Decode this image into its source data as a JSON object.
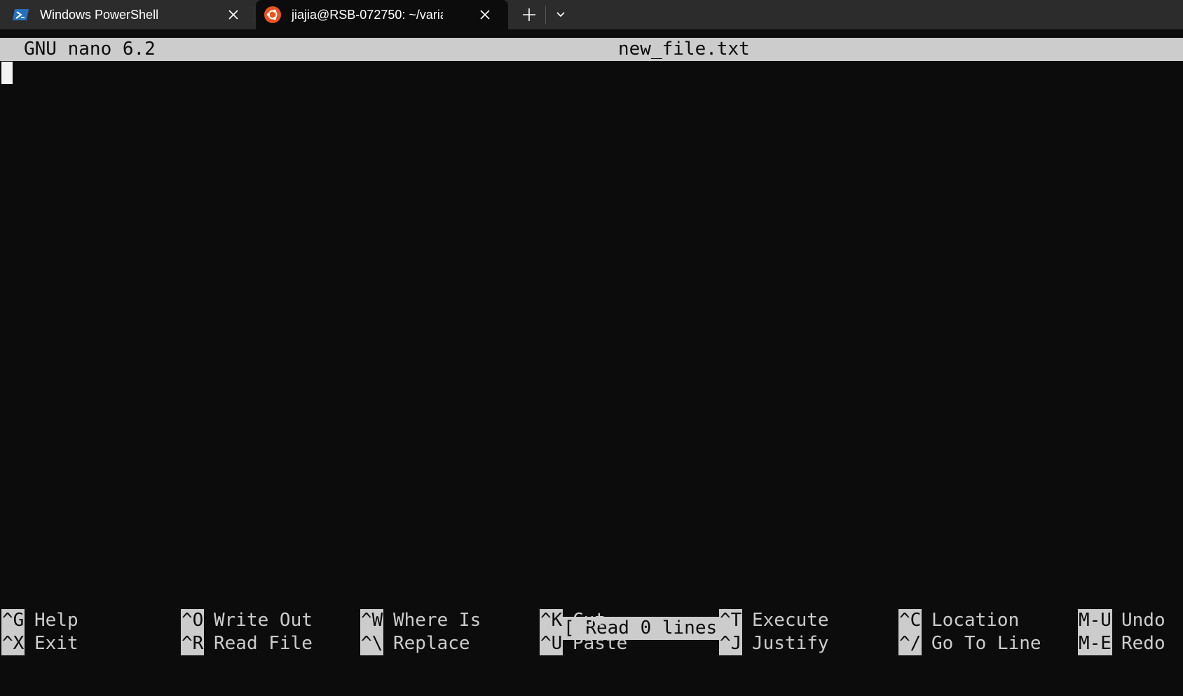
{
  "tabs": [
    {
      "title": "Windows PowerShell",
      "icon": "powershell-icon",
      "active": false
    },
    {
      "title": "jiajia@RSB-072750: ~/variant-",
      "icon": "ubuntu-icon",
      "active": true
    }
  ],
  "nano": {
    "version": "GNU nano 6.2",
    "filename": "new_file.txt",
    "status": "[ Read 0 lines ]",
    "shortcuts_row1": [
      {
        "key": "^G",
        "label": "Help"
      },
      {
        "key": "^O",
        "label": "Write Out"
      },
      {
        "key": "^W",
        "label": "Where Is"
      },
      {
        "key": "^K",
        "label": "Cut"
      },
      {
        "key": "^T",
        "label": "Execute"
      },
      {
        "key": "^C",
        "label": "Location"
      },
      {
        "key": "M-U",
        "label": "Undo"
      }
    ],
    "shortcuts_row2": [
      {
        "key": "^X",
        "label": "Exit"
      },
      {
        "key": "^R",
        "label": "Read File"
      },
      {
        "key": "^\\",
        "label": "Replace"
      },
      {
        "key": "^U",
        "label": "Paste"
      },
      {
        "key": "^J",
        "label": "Justify"
      },
      {
        "key": "^/",
        "label": "Go To Line"
      },
      {
        "key": "M-E",
        "label": "Redo"
      }
    ]
  },
  "colors": {
    "terminal_bg": "#0c0c0c",
    "tabbar_bg": "#2c2c2c",
    "nano_bar": "#cccccc",
    "ubuntu_orange": "#e95420",
    "powershell_blue": "#2671be"
  }
}
